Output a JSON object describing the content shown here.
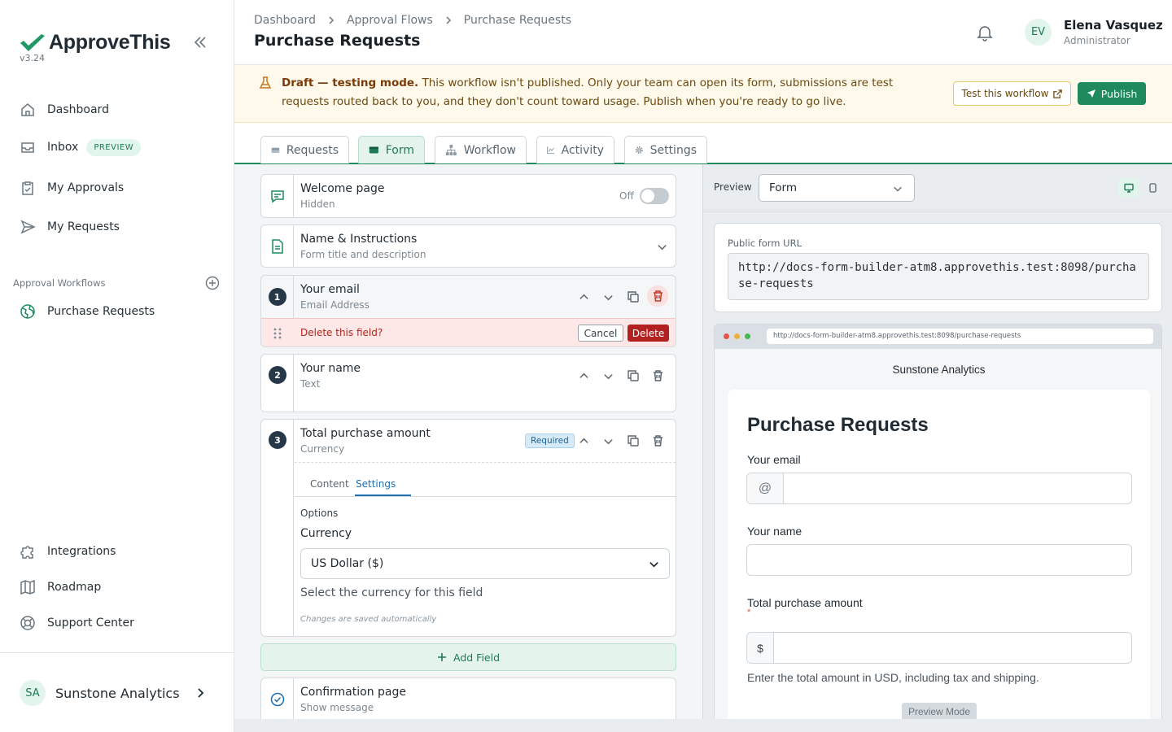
{
  "app": {
    "name": "ApproveThis",
    "version": "v3.24"
  },
  "sidebar": {
    "nav": [
      {
        "label": "Dashboard",
        "icon": "home-icon"
      },
      {
        "label": "Inbox",
        "badge": "PREVIEW",
        "icon": "inbox-icon"
      },
      {
        "label": "My Approvals",
        "icon": "clipboard-check-icon"
      },
      {
        "label": "My Requests",
        "icon": "send-icon"
      }
    ],
    "workflows_label": "Approval Workflows",
    "workflows": [
      {
        "label": "Purchase Requests"
      }
    ],
    "bottom": [
      {
        "label": "Integrations"
      },
      {
        "label": "Roadmap"
      },
      {
        "label": "Support Center"
      }
    ],
    "org": {
      "initials": "SA",
      "name": "Sunstone Analytics"
    }
  },
  "header": {
    "breadcrumb": [
      "Dashboard",
      "Approval Flows",
      "Purchase Requests"
    ],
    "title": "Purchase Requests",
    "user": {
      "initials": "EV",
      "name": "Elena Vasquez",
      "role": "Administrator"
    }
  },
  "banner": {
    "lead": "Draft — testing mode.",
    "text": " This workflow isn't published. Only your team can open its form, submissions are test requests routed back to you, and they don't count toward usage. Publish when you're ready to go live.",
    "test_label": "Test this workflow",
    "publish_label": "Publish"
  },
  "tabs": [
    "Requests",
    "Form",
    "Workflow",
    "Activity",
    "Settings"
  ],
  "form": {
    "welcome": {
      "title": "Welcome page",
      "sub": "Hidden",
      "toggle_label": "Off"
    },
    "name_instructions": {
      "title": "Name & Instructions",
      "sub": "Form title and description"
    },
    "fields": [
      {
        "num": "1",
        "title": "Your email",
        "type": "Email Address"
      },
      {
        "num": "2",
        "title": "Your name",
        "type": "Text"
      },
      {
        "num": "3",
        "title": "Total purchase amount",
        "type": "Currency",
        "badge": "Required"
      }
    ],
    "delete_confirm": {
      "text": "Delete this field?",
      "cancel": "Cancel",
      "delete": "Delete"
    },
    "field3_tabs": [
      "Content",
      "Settings"
    ],
    "options_label": "Options",
    "currency_label": "Currency",
    "currency_value": "US Dollar ($)",
    "currency_help": "Select the currency for this field",
    "autosave": "Changes are saved automatically",
    "add_field": "Add Field",
    "confirmation": {
      "title": "Confirmation page",
      "sub": "Show message"
    }
  },
  "preview": {
    "label": "Preview",
    "select_value": "Form",
    "public_url_label": "Public form URL",
    "public_url": "http://docs-form-builder-atm8.approvethis.test:8098/purchase-requests",
    "browser_url": "http://docs-form-builder-atm8.approvethis.test:8098/purchase-requests",
    "org_name": "Sunstone Analytics",
    "form_title": "Purchase Requests",
    "email_label": "Your email",
    "email_prefix": "@",
    "name_label": "Your name",
    "amount_label": "Total purchase amount",
    "required_mark": "*",
    "amount_prefix": "$",
    "amount_help": "Enter the total amount in USD, including tax and shipping.",
    "mode_badge": "Preview Mode"
  }
}
